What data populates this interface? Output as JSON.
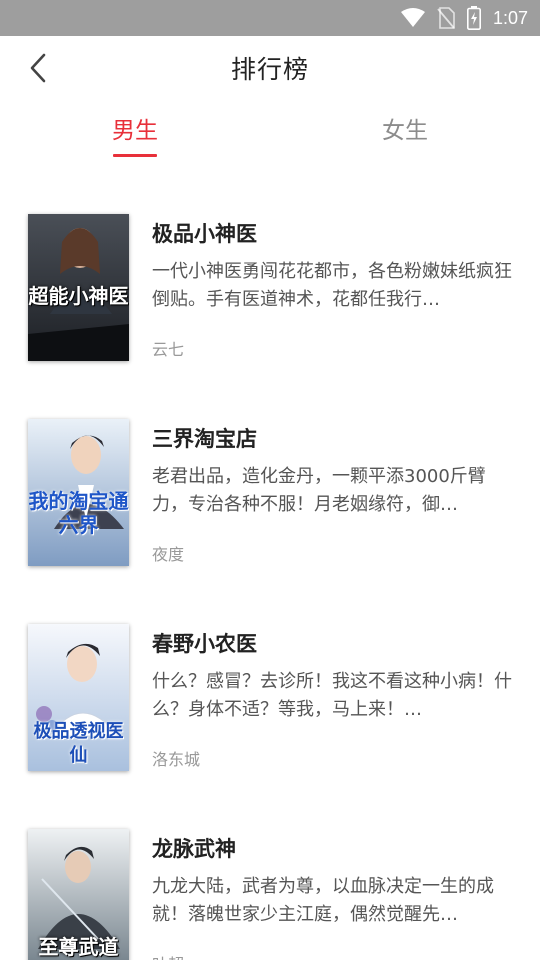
{
  "status_bar": {
    "time": "1:07"
  },
  "header": {
    "title": "排行榜"
  },
  "tabs": [
    {
      "label": "男生",
      "active": true
    },
    {
      "label": "女生",
      "active": false
    }
  ],
  "books": [
    {
      "name": "极品小神医",
      "description": "一代小神医勇闯花花都市，各色粉嫩妹纸疯狂倒贴。手有医道神术，花都任我行…",
      "author": "云七",
      "cover_text": "超能小神医",
      "cover_colors": [
        "#1c1f24",
        "#4a4f57"
      ]
    },
    {
      "name": "三界淘宝店",
      "description": "老君出品，造化金丹，一颗平添3000斤臂力，专治各种不服！月老姻缘符，御…",
      "author": "夜度",
      "cover_text": "我的淘宝通六界",
      "cover_colors": [
        "#dfe9f3",
        "#6f8fb5"
      ]
    },
    {
      "name": "春野小农医",
      "description": "什么？感冒？去诊所！我这不看这种小病！什么？身体不适？等我，马上来！…",
      "author": "洛东城",
      "cover_text": "极品透视医仙",
      "cover_colors": [
        "#f3f6fb",
        "#9db7d9"
      ]
    },
    {
      "name": "龙脉武神",
      "description": "九龙大陆，武者为尊，以血脉决定一生的成就！落魄世家少主江庭，偶然觉醒先…",
      "author": "叶超",
      "cover_text": "至尊武道",
      "cover_colors": [
        "#e9edf0",
        "#6c7a84"
      ]
    }
  ]
}
